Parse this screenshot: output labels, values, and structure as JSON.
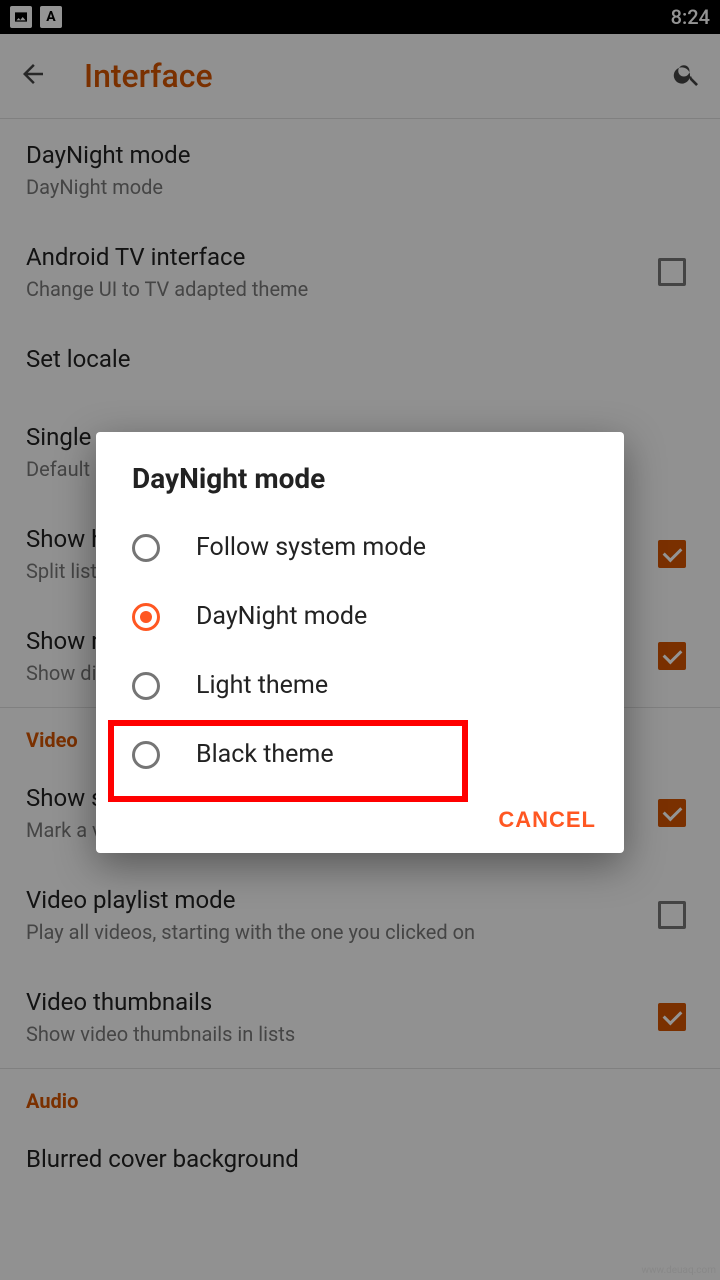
{
  "status": {
    "time": "8:24"
  },
  "toolbar": {
    "title": "Interface"
  },
  "settings": {
    "daynight": {
      "title": "DayNight mode",
      "subtitle": "DayNight mode"
    },
    "tv": {
      "title": "Android TV interface",
      "subtitle": "Change UI to TV adapted theme"
    },
    "locale": {
      "title": "Set locale"
    },
    "single": {
      "title_partial": "Single",
      "subtitle_partial": "Default"
    },
    "show_h": {
      "title_partial": "Show h",
      "subtitle_partial": "Split list"
    },
    "show_n": {
      "title_partial": "Show n",
      "subtitle_partial": "Show di"
    },
    "video_header": "Video",
    "show_seen": {
      "title_partial": "Show s",
      "subtitle": "Mark a video as seen when you play it until the end"
    },
    "playlist": {
      "title": "Video playlist mode",
      "subtitle": "Play all videos, starting with the one you clicked on"
    },
    "thumbs": {
      "title": "Video thumbnails",
      "subtitle": "Show video thumbnails in lists"
    },
    "audio_header": "Audio",
    "blurred": {
      "title_partial": "Blurred cover background"
    }
  },
  "dialog": {
    "title": "DayNight mode",
    "options": [
      "Follow system mode",
      "DayNight mode",
      "Light theme",
      "Black theme"
    ],
    "selected_index": 1,
    "highlighted_index": 3,
    "cancel": "CANCEL"
  },
  "watermark": "www.deuaq.com"
}
